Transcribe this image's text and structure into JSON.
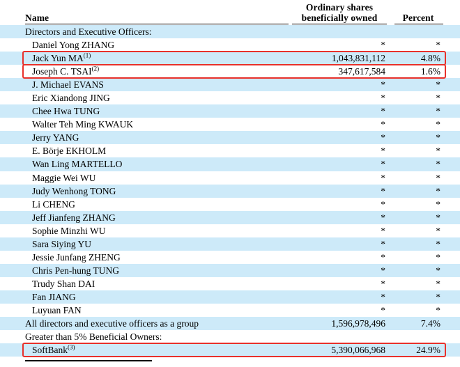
{
  "document": {
    "title": "Beneficial Ownership Table",
    "shaded_row_color": "#cdeaf9",
    "highlight_color": "#e8312b"
  },
  "table": {
    "headers": {
      "name": "Name",
      "shares_line1": "Ordinary shares",
      "shares_line2": "beneficially owned",
      "percent": "Percent"
    },
    "rows": [
      {
        "name": "Directors and Executive Officers:",
        "shares": "",
        "percent": "",
        "type": "section",
        "indent": false,
        "shaded": true,
        "highlight": false
      },
      {
        "name": "Daniel Yong ZHANG",
        "shares": "*",
        "percent": "*",
        "type": "person",
        "indent": true,
        "shaded": false,
        "highlight": false
      },
      {
        "name": "Jack Yun MA",
        "sup": "(1)",
        "shares": "1,043,831,112",
        "percent": "4.8%",
        "type": "person",
        "indent": true,
        "shaded": true,
        "highlight": true
      },
      {
        "name": "Joseph C. TSAI",
        "sup": "(2)",
        "shares": "347,617,584",
        "percent": "1.6%",
        "type": "person",
        "indent": true,
        "shaded": false,
        "highlight": true
      },
      {
        "name": "J. Michael EVANS",
        "shares": "*",
        "percent": "*",
        "type": "person",
        "indent": true,
        "shaded": true,
        "highlight": false
      },
      {
        "name": "Eric Xiandong JING",
        "shares": "*",
        "percent": "*",
        "type": "person",
        "indent": true,
        "shaded": false,
        "highlight": false
      },
      {
        "name": "Chee Hwa TUNG",
        "shares": "*",
        "percent": "*",
        "type": "person",
        "indent": true,
        "shaded": true,
        "highlight": false
      },
      {
        "name": "Walter Teh Ming KWAUK",
        "shares": "*",
        "percent": "*",
        "type": "person",
        "indent": true,
        "shaded": false,
        "highlight": false
      },
      {
        "name": "Jerry YANG",
        "shares": "*",
        "percent": "*",
        "type": "person",
        "indent": true,
        "shaded": true,
        "highlight": false
      },
      {
        "name": "E. Börje EKHOLM",
        "shares": "*",
        "percent": "*",
        "type": "person",
        "indent": true,
        "shaded": false,
        "highlight": false
      },
      {
        "name": "Wan Ling MARTELLO",
        "shares": "*",
        "percent": "*",
        "type": "person",
        "indent": true,
        "shaded": true,
        "highlight": false
      },
      {
        "name": "Maggie Wei WU",
        "shares": "*",
        "percent": "*",
        "type": "person",
        "indent": true,
        "shaded": false,
        "highlight": false
      },
      {
        "name": "Judy Wenhong TONG",
        "shares": "*",
        "percent": "*",
        "type": "person",
        "indent": true,
        "shaded": true,
        "highlight": false
      },
      {
        "name": "Li CHENG",
        "shares": "*",
        "percent": "*",
        "type": "person",
        "indent": true,
        "shaded": false,
        "highlight": false
      },
      {
        "name": "Jeff Jianfeng ZHANG",
        "shares": "*",
        "percent": "*",
        "type": "person",
        "indent": true,
        "shaded": true,
        "highlight": false
      },
      {
        "name": "Sophie Minzhi WU",
        "shares": "*",
        "percent": "*",
        "type": "person",
        "indent": true,
        "shaded": false,
        "highlight": false
      },
      {
        "name": "Sara Siying YU",
        "shares": "*",
        "percent": "*",
        "type": "person",
        "indent": true,
        "shaded": true,
        "highlight": false
      },
      {
        "name": "Jessie Junfang ZHENG",
        "shares": "*",
        "percent": "*",
        "type": "person",
        "indent": true,
        "shaded": false,
        "highlight": false
      },
      {
        "name": "Chris Pen-hung TUNG",
        "shares": "*",
        "percent": "*",
        "type": "person",
        "indent": true,
        "shaded": true,
        "highlight": false
      },
      {
        "name": "Trudy Shan DAI",
        "shares": "*",
        "percent": "*",
        "type": "person",
        "indent": true,
        "shaded": false,
        "highlight": false
      },
      {
        "name": "Fan JIANG",
        "shares": "*",
        "percent": "*",
        "type": "person",
        "indent": true,
        "shaded": true,
        "highlight": false
      },
      {
        "name": "Luyuan FAN",
        "shares": "*",
        "percent": "*",
        "type": "person",
        "indent": true,
        "shaded": false,
        "highlight": false
      },
      {
        "name": "All directors and executive officers as a group",
        "shares": "1,596,978,496",
        "percent": "7.4%",
        "type": "total",
        "indent": false,
        "shaded": true,
        "highlight": false
      },
      {
        "name": "Greater than 5% Beneficial Owners:",
        "shares": "",
        "percent": "",
        "type": "section",
        "indent": false,
        "shaded": false,
        "highlight": false
      },
      {
        "name": "SoftBank",
        "sup": "(3)",
        "shares": "5,390,066,968",
        "percent": "24.9%",
        "type": "person",
        "indent": true,
        "shaded": true,
        "highlight": true
      }
    ]
  }
}
